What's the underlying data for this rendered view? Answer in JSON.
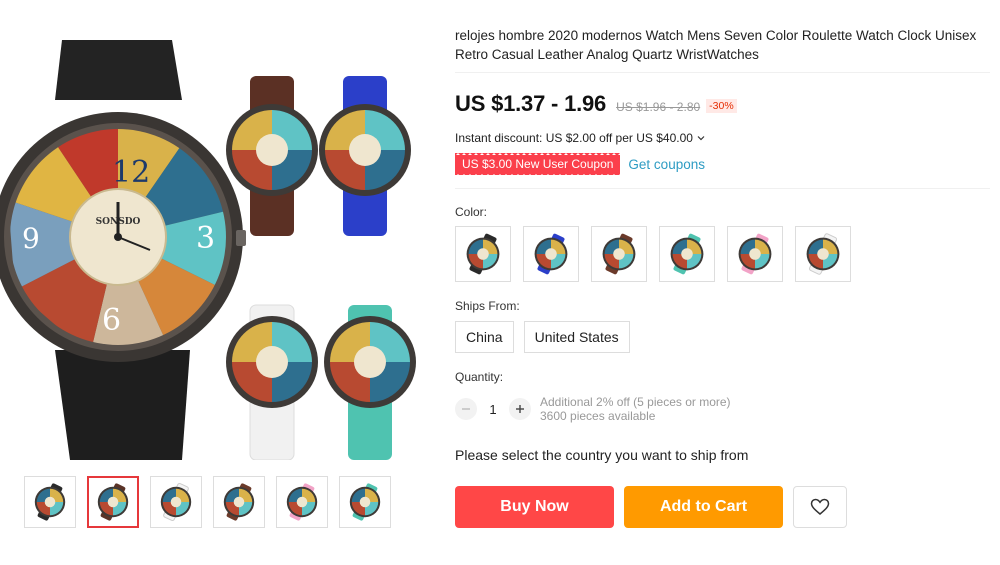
{
  "product": {
    "title": "relojes hombre 2020 modernos Watch Mens Seven Color Roulette Watch Clock Unisex Retro Casual Leather Analog Quartz WristWatches",
    "main_image": {
      "icon": "watch-collage-image",
      "brand_text": "SONSDO"
    }
  },
  "gallery": {
    "thumbnails": [
      {
        "icon": "black-watch-thumbnail",
        "strap": "#2a2a2a"
      },
      {
        "icon": "multi-watch-thumbnail",
        "strap": "#5a3327",
        "active": true
      },
      {
        "icon": "white-watch-thumbnail",
        "strap": "#f4f4f4"
      },
      {
        "icon": "brown-watch-thumbnail",
        "strap": "#6b3a2a"
      },
      {
        "icon": "pink-watch-thumbnail",
        "strap": "#f2a3c7"
      },
      {
        "icon": "teal-watch-thumbnail",
        "strap": "#4fc3b0"
      }
    ]
  },
  "pricing": {
    "price": "US $1.37 - 1.96",
    "original_price": "US $1.96 - 2.80",
    "discount": "-30%",
    "instant_discount": "Instant discount: US $2.00 off per US $40.00",
    "coupon": "US $3.00 New User Coupon",
    "get_coupons": "Get coupons"
  },
  "color": {
    "label": "Color:",
    "options": [
      {
        "icon": "black-watch-swatch",
        "strap": "#2a2a2a"
      },
      {
        "icon": "blue-watch-swatch",
        "strap": "#2b3fc9"
      },
      {
        "icon": "brown-watch-swatch",
        "strap": "#6b3a2a"
      },
      {
        "icon": "teal-watch-swatch",
        "strap": "#4fc3b0"
      },
      {
        "icon": "pink-watch-swatch",
        "strap": "#f2a3c7"
      },
      {
        "icon": "white-watch-swatch",
        "strap": "#f4f4f4"
      }
    ]
  },
  "ships_from": {
    "label": "Ships From:",
    "options": [
      "China",
      "United States"
    ]
  },
  "quantity": {
    "label": "Quantity:",
    "value": "1",
    "additional": "Additional 2% off (5 pieces or more)",
    "available": "3600 pieces available"
  },
  "ship_note": "Please select the country you want to ship from",
  "actions": {
    "buy_now": "Buy Now",
    "add_to_cart": "Add to Cart"
  },
  "colors": {
    "buy": "#ff4747",
    "cart": "#ff9a00",
    "coupon": "#fb3f4b",
    "link": "#2e9cc3"
  }
}
